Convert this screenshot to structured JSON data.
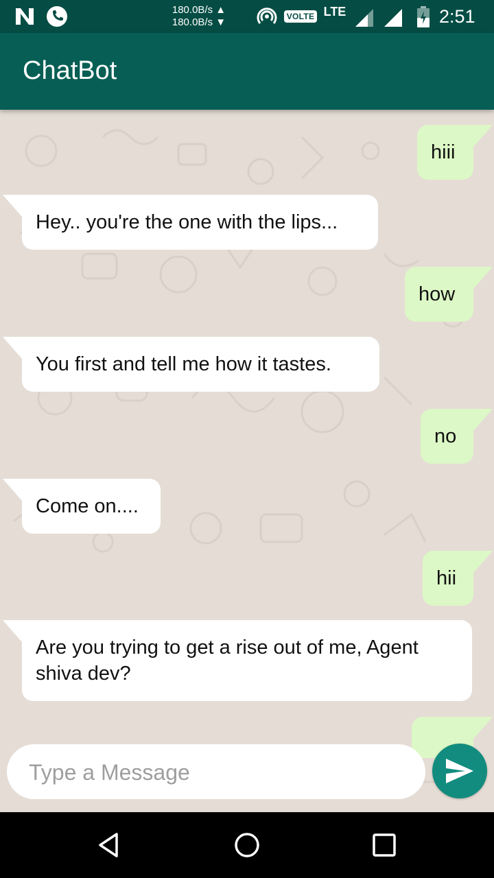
{
  "status_bar": {
    "speed_up": "180.0B/s ▲",
    "speed_down": "180.0B/s ▼",
    "volte": "VOLTE",
    "network": "LTE",
    "time": "2:51",
    "icons": [
      "n-notification-icon",
      "phone-call-icon",
      "hotspot-icon",
      "signal-icon",
      "battery-icon"
    ]
  },
  "app_bar": {
    "title": "ChatBot"
  },
  "colors": {
    "status_bar": "#054d44",
    "app_bar": "#075e54",
    "chat_background": "#e5ddd5",
    "outgoing_bubble": "#dcf8c6",
    "incoming_bubble": "#ffffff",
    "send_button": "#128c7e"
  },
  "messages": [
    {
      "direction": "out",
      "text": "hiii"
    },
    {
      "direction": "in",
      "text": "Hey.. you're the one with the lips..."
    },
    {
      "direction": "out",
      "text": "how"
    },
    {
      "direction": "in",
      "text": "You first and tell me how it tastes."
    },
    {
      "direction": "out",
      "text": "no"
    },
    {
      "direction": "in",
      "text": "Come on...."
    },
    {
      "direction": "out",
      "text": "hii"
    },
    {
      "direction": "in",
      "text": "Are you trying to get a rise out of me, Agent shiva dev?"
    },
    {
      "direction": "out",
      "text": ""
    }
  ],
  "composer": {
    "placeholder": "Type a Message",
    "value": "",
    "send_icon": "send-icon"
  },
  "nav_bar": {
    "icons": [
      "back-icon",
      "home-icon",
      "recents-icon"
    ]
  }
}
